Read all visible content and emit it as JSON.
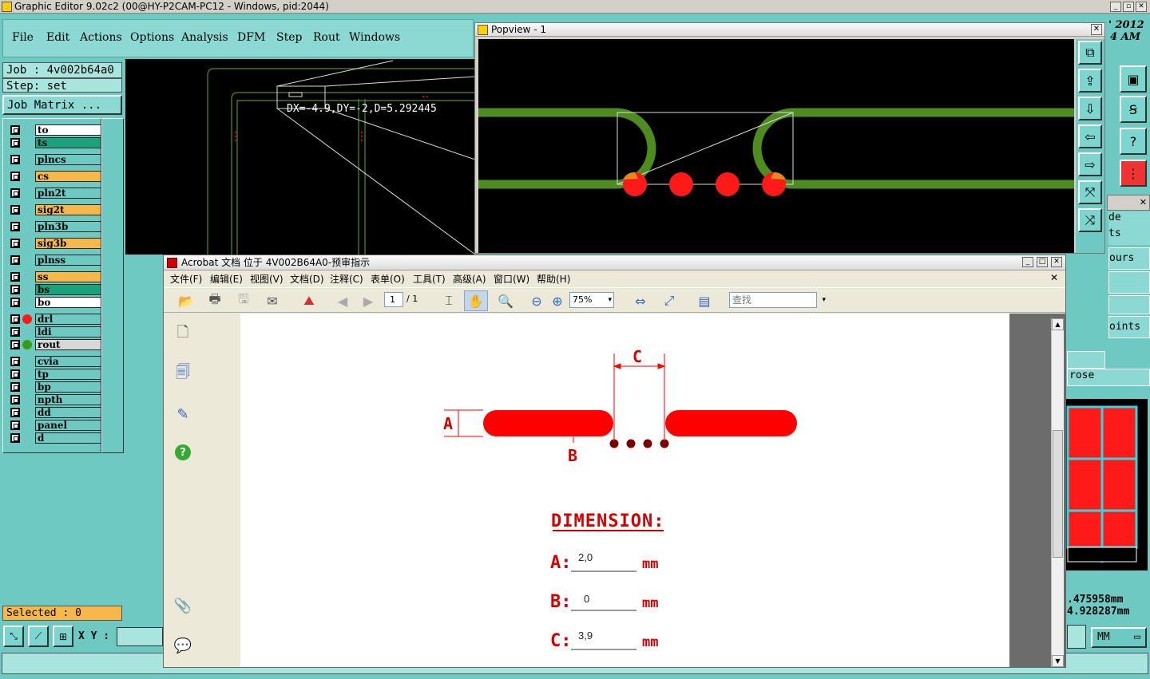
{
  "app": {
    "title": "Graphic Editor 9.02c2 (00@HY-P2CAM-PC12 - Windows, pid:2044)",
    "menus": [
      "File",
      "Edit",
      "Actions",
      "Options",
      "Analysis",
      "DFM",
      "Step",
      "Rout",
      "Windows"
    ],
    "clock_year": "' 2012",
    "clock_time": "4 AM"
  },
  "left_panel": {
    "job": "Job : 4v002b64a0",
    "step": "Step: set",
    "job_matrix": "Job Matrix ...",
    "selected": "Selected : 0",
    "xy_label": "X Y :",
    "layers": [
      {
        "name": "to",
        "color": "#ffffff"
      },
      {
        "name": "ts",
        "color": "#1aa37a"
      },
      {
        "name": "plncs",
        "color": "#6ec9c3"
      },
      {
        "name": "cs",
        "color": "#f7b84a"
      },
      {
        "name": "pln2t",
        "color": "#6ec9c3"
      },
      {
        "name": "sig2t",
        "color": "#f7b84a"
      },
      {
        "name": "pln3b",
        "color": "#6ec9c3"
      },
      {
        "name": "sig3b",
        "color": "#f7b84a"
      },
      {
        "name": "plnss",
        "color": "#6ec9c3"
      },
      {
        "name": "ss",
        "color": "#f7b84a"
      },
      {
        "name": "bs",
        "color": "#1aa37a"
      },
      {
        "name": "bo",
        "color": "#ffffff"
      },
      {
        "name": "drl",
        "color": "#6ec9c3"
      },
      {
        "name": "ldi",
        "color": "#6ec9c3"
      },
      {
        "name": "rout",
        "color": "#d8d8d8"
      },
      {
        "name": "cvia",
        "color": "#6ec9c3"
      },
      {
        "name": "tp",
        "color": "#6ec9c3"
      },
      {
        "name": "bp",
        "color": "#6ec9c3"
      },
      {
        "name": "npth",
        "color": "#6ec9c3"
      },
      {
        "name": "dd",
        "color": "#6ec9c3"
      },
      {
        "name": "panel",
        "color": "#6ec9c3"
      },
      {
        "name": "d",
        "color": "#6ec9c3"
      }
    ]
  },
  "canvas": {
    "measure": "DX=-4.9,DY=-2,D=5.292445"
  },
  "popview": {
    "title": "Popview - 1"
  },
  "right_panel": {
    "labels": [
      "de",
      "ts",
      "ours",
      "oints",
      "rose"
    ],
    "coord_x": ".475958mm",
    "coord_y": "4.928287mm",
    "unit": "MM"
  },
  "acrobat": {
    "title": "Acrobat 文档 位于 4V002B64A0-预审指示",
    "menus": [
      "文件(F)",
      "编辑(E)",
      "视图(V)",
      "文档(D)",
      "注释(C)",
      "表单(O)",
      "工具(T)",
      "高级(A)",
      "窗口(W)",
      "帮助(H)"
    ],
    "page_current": "1",
    "page_total": "/ 1",
    "zoom": "75%",
    "search_placeholder": "查找",
    "doc": {
      "label_c_top": "C",
      "label_a": "A",
      "label_b": "B",
      "heading": "DIMENSION:",
      "rows": [
        {
          "letter": "A:",
          "value": "2,0",
          "unit": "mm"
        },
        {
          "letter": "B:",
          "value": "0",
          "unit": "mm"
        },
        {
          "letter": "C:",
          "value": "3,9",
          "unit": "mm"
        }
      ]
    }
  }
}
